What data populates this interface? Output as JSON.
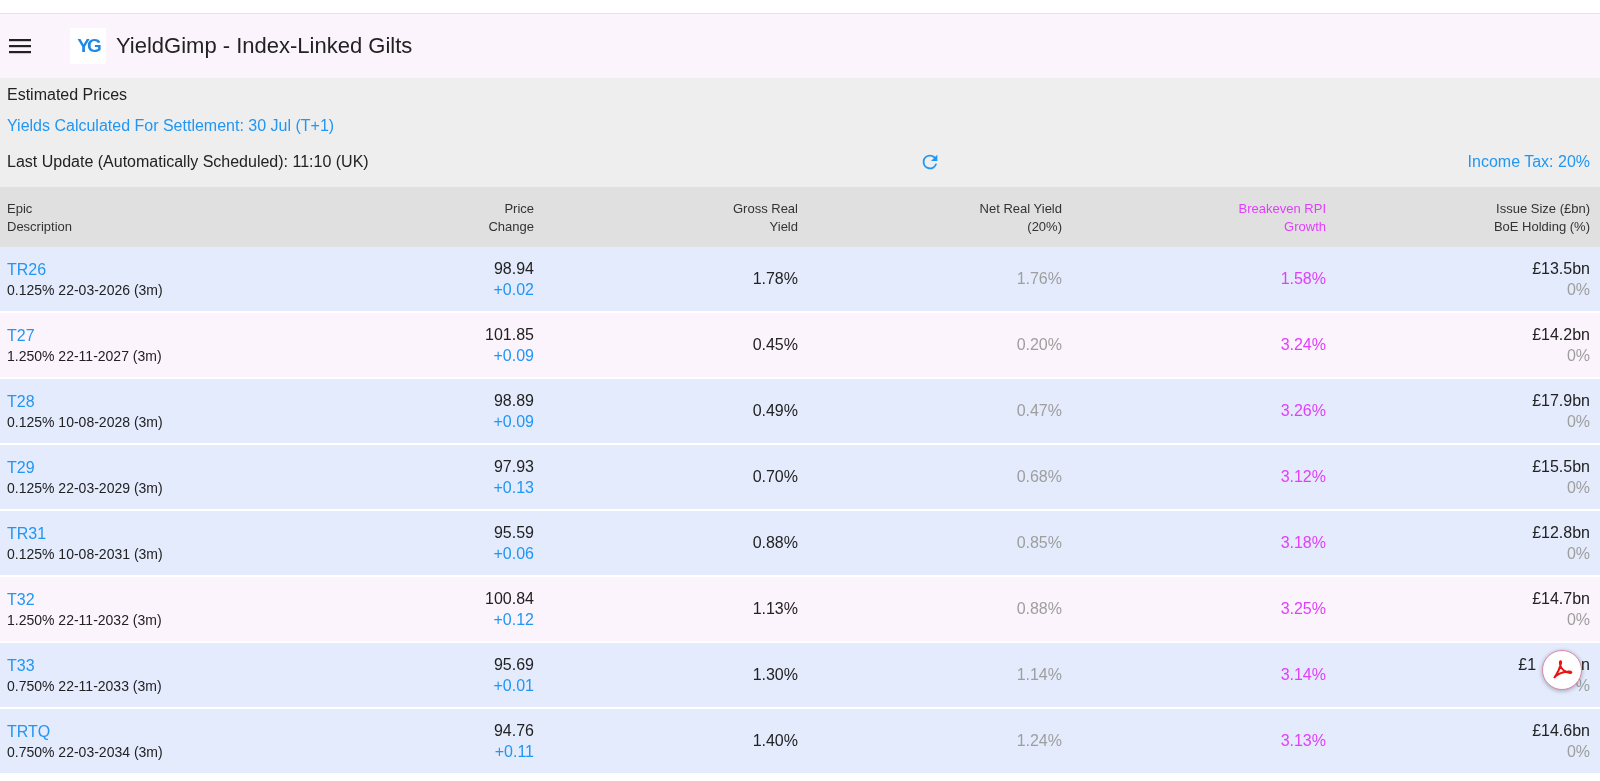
{
  "app_bar": {
    "title": "YieldGimp - Index-Linked Gilts",
    "logo": "YG"
  },
  "info": {
    "heading": "Estimated Prices",
    "settlement": "Yields Calculated For Settlement: 30 Jul (T+1)",
    "last_update": "Last Update (Automatically Scheduled): 11:10 (UK)",
    "income_tax": "Income Tax: 20%"
  },
  "table": {
    "columns": [
      [
        "Epic",
        "Description"
      ],
      [
        "Price",
        "Change"
      ],
      [
        "Gross Real",
        "Yield"
      ],
      [
        "Net Real Yield",
        "(20%)"
      ],
      [
        "Breakeven RPI",
        "Growth"
      ],
      [
        "Issue Size (£bn)",
        "BoE Holding (%)"
      ]
    ],
    "rows": [
      {
        "epic": "TR26",
        "description": "0.125% 22-03-2026 (3m)",
        "price": "98.94",
        "change": "+0.02",
        "gross_yield": "1.78%",
        "net_yield": "1.76%",
        "breakeven": "1.58%",
        "issue_size": "£13.5bn",
        "boe_holding": "0%",
        "highlighted": false
      },
      {
        "epic": "T27",
        "description": "1.250% 22-11-2027 (3m)",
        "price": "101.85",
        "change": "+0.09",
        "gross_yield": "0.45%",
        "net_yield": "0.20%",
        "breakeven": "3.24%",
        "issue_size": "£14.2bn",
        "boe_holding": "0%",
        "highlighted": true
      },
      {
        "epic": "T28",
        "description": "0.125% 10-08-2028 (3m)",
        "price": "98.89",
        "change": "+0.09",
        "gross_yield": "0.49%",
        "net_yield": "0.47%",
        "breakeven": "3.26%",
        "issue_size": "£17.9bn",
        "boe_holding": "0%",
        "highlighted": false
      },
      {
        "epic": "T29",
        "description": "0.125% 22-03-2029 (3m)",
        "price": "97.93",
        "change": "+0.13",
        "gross_yield": "0.70%",
        "net_yield": "0.68%",
        "breakeven": "3.12%",
        "issue_size": "£15.5bn",
        "boe_holding": "0%",
        "highlighted": false
      },
      {
        "epic": "TR31",
        "description": "0.125% 10-08-2031 (3m)",
        "price": "95.59",
        "change": "+0.06",
        "gross_yield": "0.88%",
        "net_yield": "0.85%",
        "breakeven": "3.18%",
        "issue_size": "£12.8bn",
        "boe_holding": "0%",
        "highlighted": false
      },
      {
        "epic": "T32",
        "description": "1.250% 22-11-2032 (3m)",
        "price": "100.84",
        "change": "+0.12",
        "gross_yield": "1.13%",
        "net_yield": "0.88%",
        "breakeven": "3.25%",
        "issue_size": "£14.7bn",
        "boe_holding": "0%",
        "highlighted": true
      },
      {
        "epic": "T33",
        "description": "0.750% 22-11-2033 (3m)",
        "price": "95.69",
        "change": "+0.01",
        "gross_yield": "1.30%",
        "net_yield": "1.14%",
        "breakeven": "3.14%",
        "issue_size": "£1",
        "issue_size_end": "n",
        "boe_holding": "%",
        "highlighted": false
      },
      {
        "epic": "TRTQ",
        "description": "0.750% 22-03-2034 (3m)",
        "price": "94.76",
        "change": "+0.11",
        "gross_yield": "1.40%",
        "net_yield": "1.24%",
        "breakeven": "3.13%",
        "issue_size": "£14.6bn",
        "boe_holding": "0%",
        "highlighted": false
      }
    ]
  }
}
